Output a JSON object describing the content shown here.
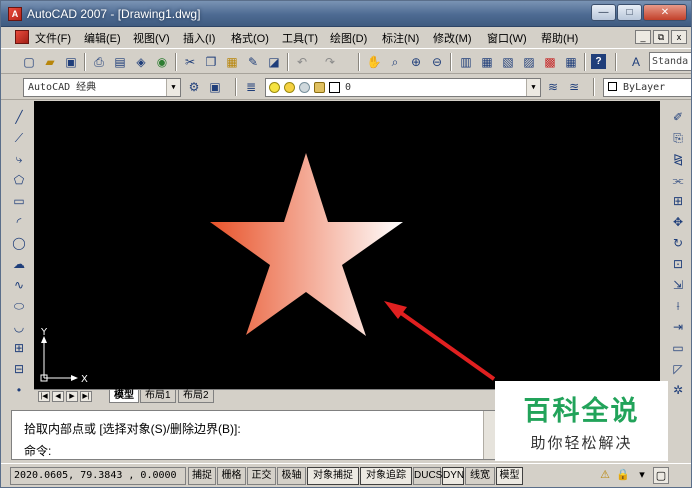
{
  "window": {
    "title": "AutoCAD 2007 - [Drawing1.dwg]",
    "app_icon": "A",
    "controls": {
      "minimize": "—",
      "maximize": "□",
      "close": "✕"
    }
  },
  "menu": {
    "items": [
      "文件(F)",
      "编辑(E)",
      "视图(V)",
      "插入(I)",
      "格式(O)",
      "工具(T)",
      "绘图(D)",
      "标注(N)",
      "修改(M)",
      "窗口(W)",
      "帮助(H)"
    ],
    "mdi": {
      "minimize": "_",
      "restore": "⧉",
      "close": "x"
    }
  },
  "toolbar": {
    "text_style": "Standa",
    "workspace": "AutoCAD 经典",
    "layer": "0",
    "color": "ByLayer"
  },
  "layout_tabs": {
    "nav": [
      "|◀",
      "◀",
      "▶",
      "▶|"
    ],
    "tabs": [
      "模型",
      "布局1",
      "布局2"
    ],
    "active": "模型"
  },
  "command": {
    "line1": "拾取内部点或 [选择对象(S)/删除边界(B)]:",
    "line2": "命令:"
  },
  "status": {
    "coordinates": "2020.0605, 79.3843 , 0.0000",
    "buttons": [
      "捕捉",
      "栅格",
      "正交",
      "极轴",
      "对象捕捉",
      "对象追踪",
      "DUCS",
      "DYN",
      "线宽",
      "模型"
    ],
    "active_buttons": [
      "对象捕捉",
      "对象追踪",
      "DYN",
      "模型"
    ]
  },
  "canvas": {
    "ucs_x": "X",
    "ucs_y": "Y",
    "star_gradient": [
      "#e8532a",
      "#ffffff"
    ],
    "arrow_color": "#e02020"
  },
  "watermark": {
    "title": "百科全说",
    "subtitle": "助你轻松解决"
  },
  "colors": {
    "titlebar": "#4d6a92",
    "canvas_bg": "#000000",
    "watermark_green": "#22a35a"
  }
}
